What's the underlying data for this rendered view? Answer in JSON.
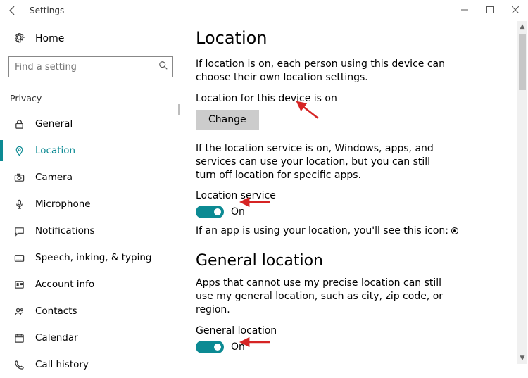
{
  "window": {
    "title": "Settings"
  },
  "sidebar": {
    "home": "Home",
    "search_placeholder": "Find a setting",
    "group": "Privacy",
    "items": [
      {
        "label": "General"
      },
      {
        "label": "Location"
      },
      {
        "label": "Camera"
      },
      {
        "label": "Microphone"
      },
      {
        "label": "Notifications"
      },
      {
        "label": "Speech, inking, & typing"
      },
      {
        "label": "Account info"
      },
      {
        "label": "Contacts"
      },
      {
        "label": "Calendar"
      },
      {
        "label": "Call history"
      }
    ]
  },
  "content": {
    "heading": "Location",
    "intro": "If location is on, each person using this device can choose their own location settings.",
    "device_status": "Location for this device is on",
    "change": "Change",
    "service_desc": "If the location service is on, Windows, apps, and services can use your location, but you can still turn off location for specific apps.",
    "service_label": "Location service",
    "service_toggle": "On",
    "icon_note": "If an app is using your location, you'll see this icon:",
    "general_heading": "General location",
    "general_desc": "Apps that cannot use my precise location can still use my general location, such as city, zip code, or region.",
    "general_label": "General location",
    "general_toggle": "On"
  },
  "colors": {
    "accent": "#0c8a93",
    "arrow": "#d62424"
  }
}
